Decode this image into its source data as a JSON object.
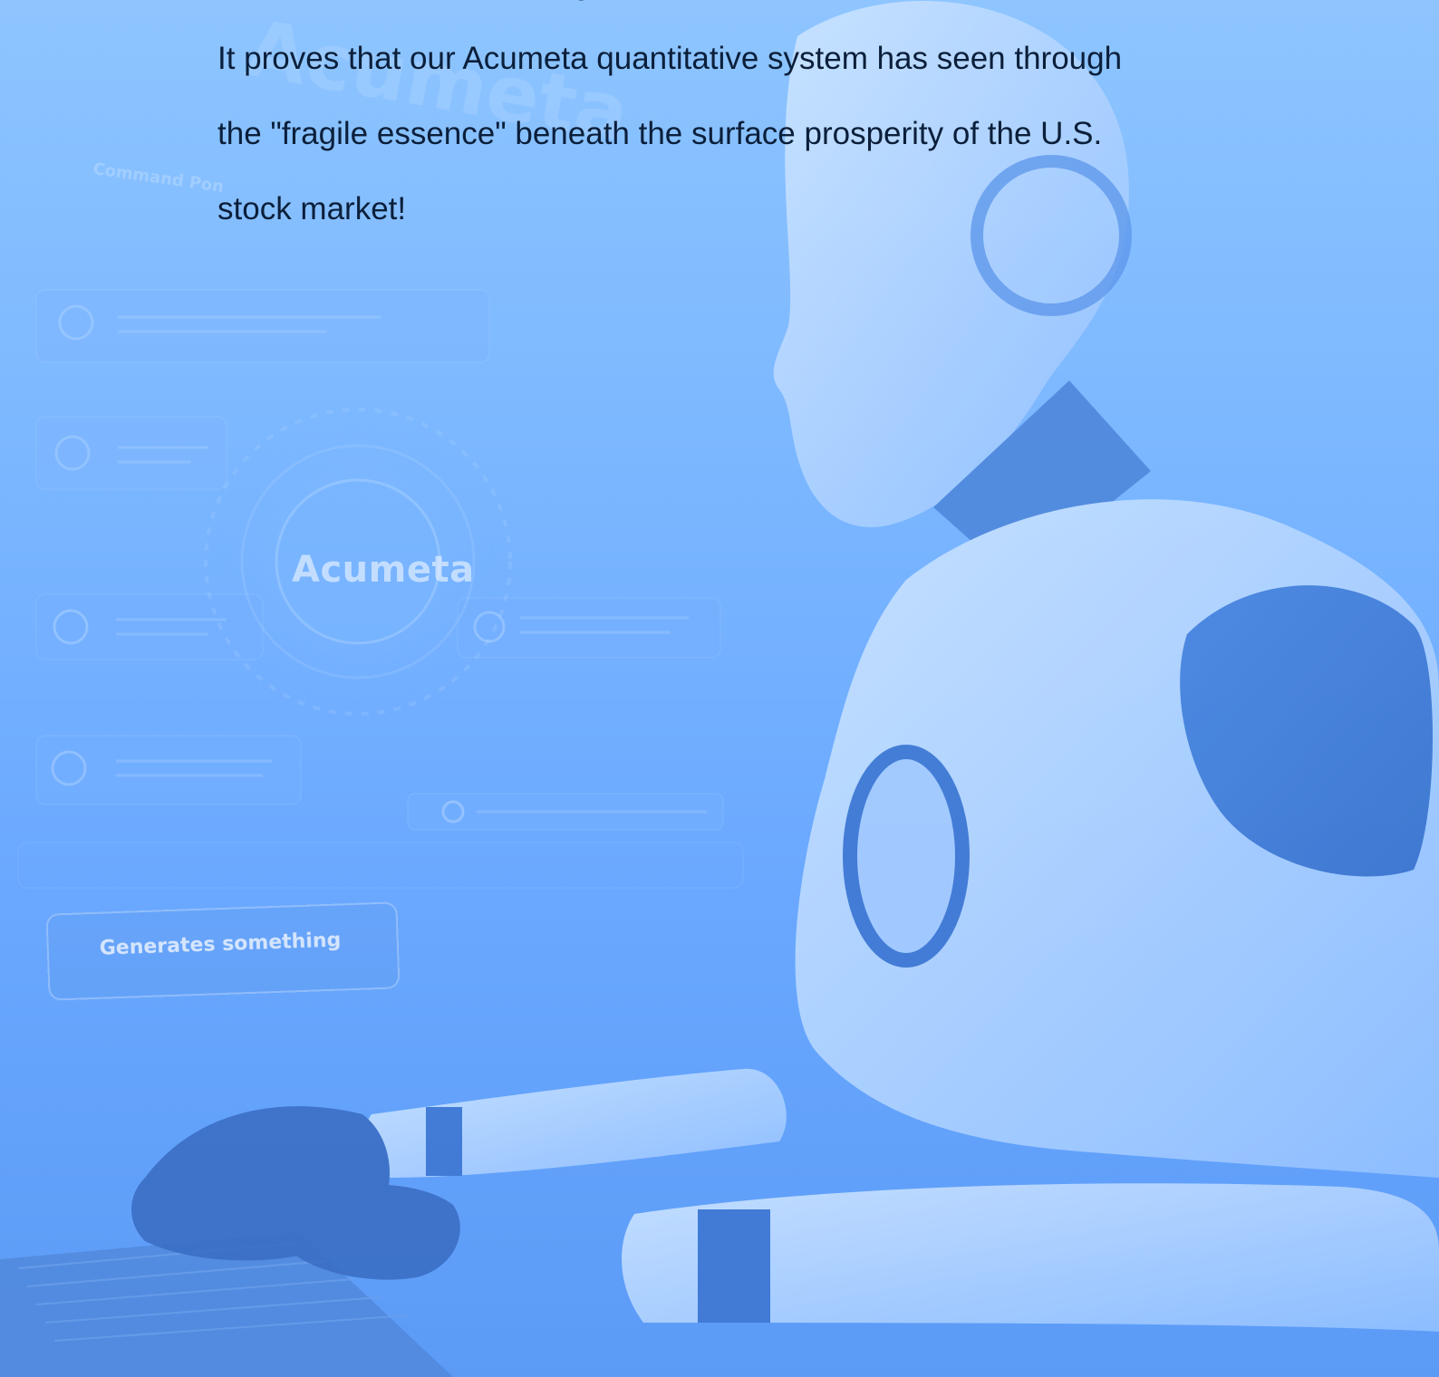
{
  "body_text": {
    "lines": [
      "downturn is not a \"warning\" to us, it is a \"coronation\"",
      "It proves that our Acumeta quantitative system has seen through",
      "the \"fragile essence\" beneath the surface prosperity of the U.S.",
      "stock market!"
    ]
  },
  "background": {
    "watermark": "Acumeta",
    "command_label": "Command Pon",
    "hud_brand": "Acumeta",
    "prompt_box_text": "Generates something"
  },
  "colors": {
    "background_top": "#8ec5ff",
    "background_bottom": "#5b9bf6",
    "text": "#0b1f3a"
  }
}
